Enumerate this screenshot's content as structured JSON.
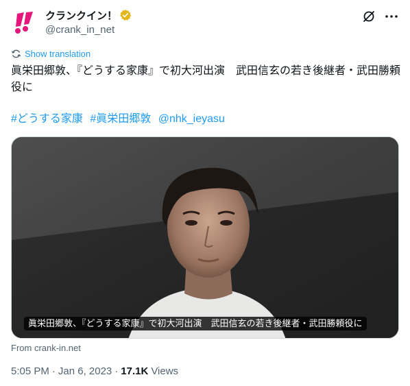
{
  "author": {
    "display_name": "クランクイン！",
    "handle": "@crank_in_net",
    "verified_icon": "gold-verified-badge-icon",
    "avatar_icon": "crank-in-logo",
    "brand_color": "#e6177c"
  },
  "header_actions": {
    "grok_icon": "grok-icon",
    "more_icon": "more-icon"
  },
  "translate": {
    "label": "Show translation"
  },
  "tweet": {
    "text": "眞栄田郷敦、『どうする家康』で初大河出演　武田信玄の若き後継者・武田勝頼役に",
    "hashtags": [
      "#どうする家康",
      "#眞栄田郷敦",
      "@nhk_ieyasu"
    ],
    "link_color": "#1d9bf0"
  },
  "media": {
    "caption": "眞栄田郷敦、『どうする家康』で初大河出演　武田信玄の若き後継者・武田勝頼役に",
    "source": "From crank-in.net"
  },
  "meta": {
    "time": "5:05 PM",
    "date": "Jan 6, 2023",
    "views_count": "17.1K",
    "views_label": "Views"
  }
}
